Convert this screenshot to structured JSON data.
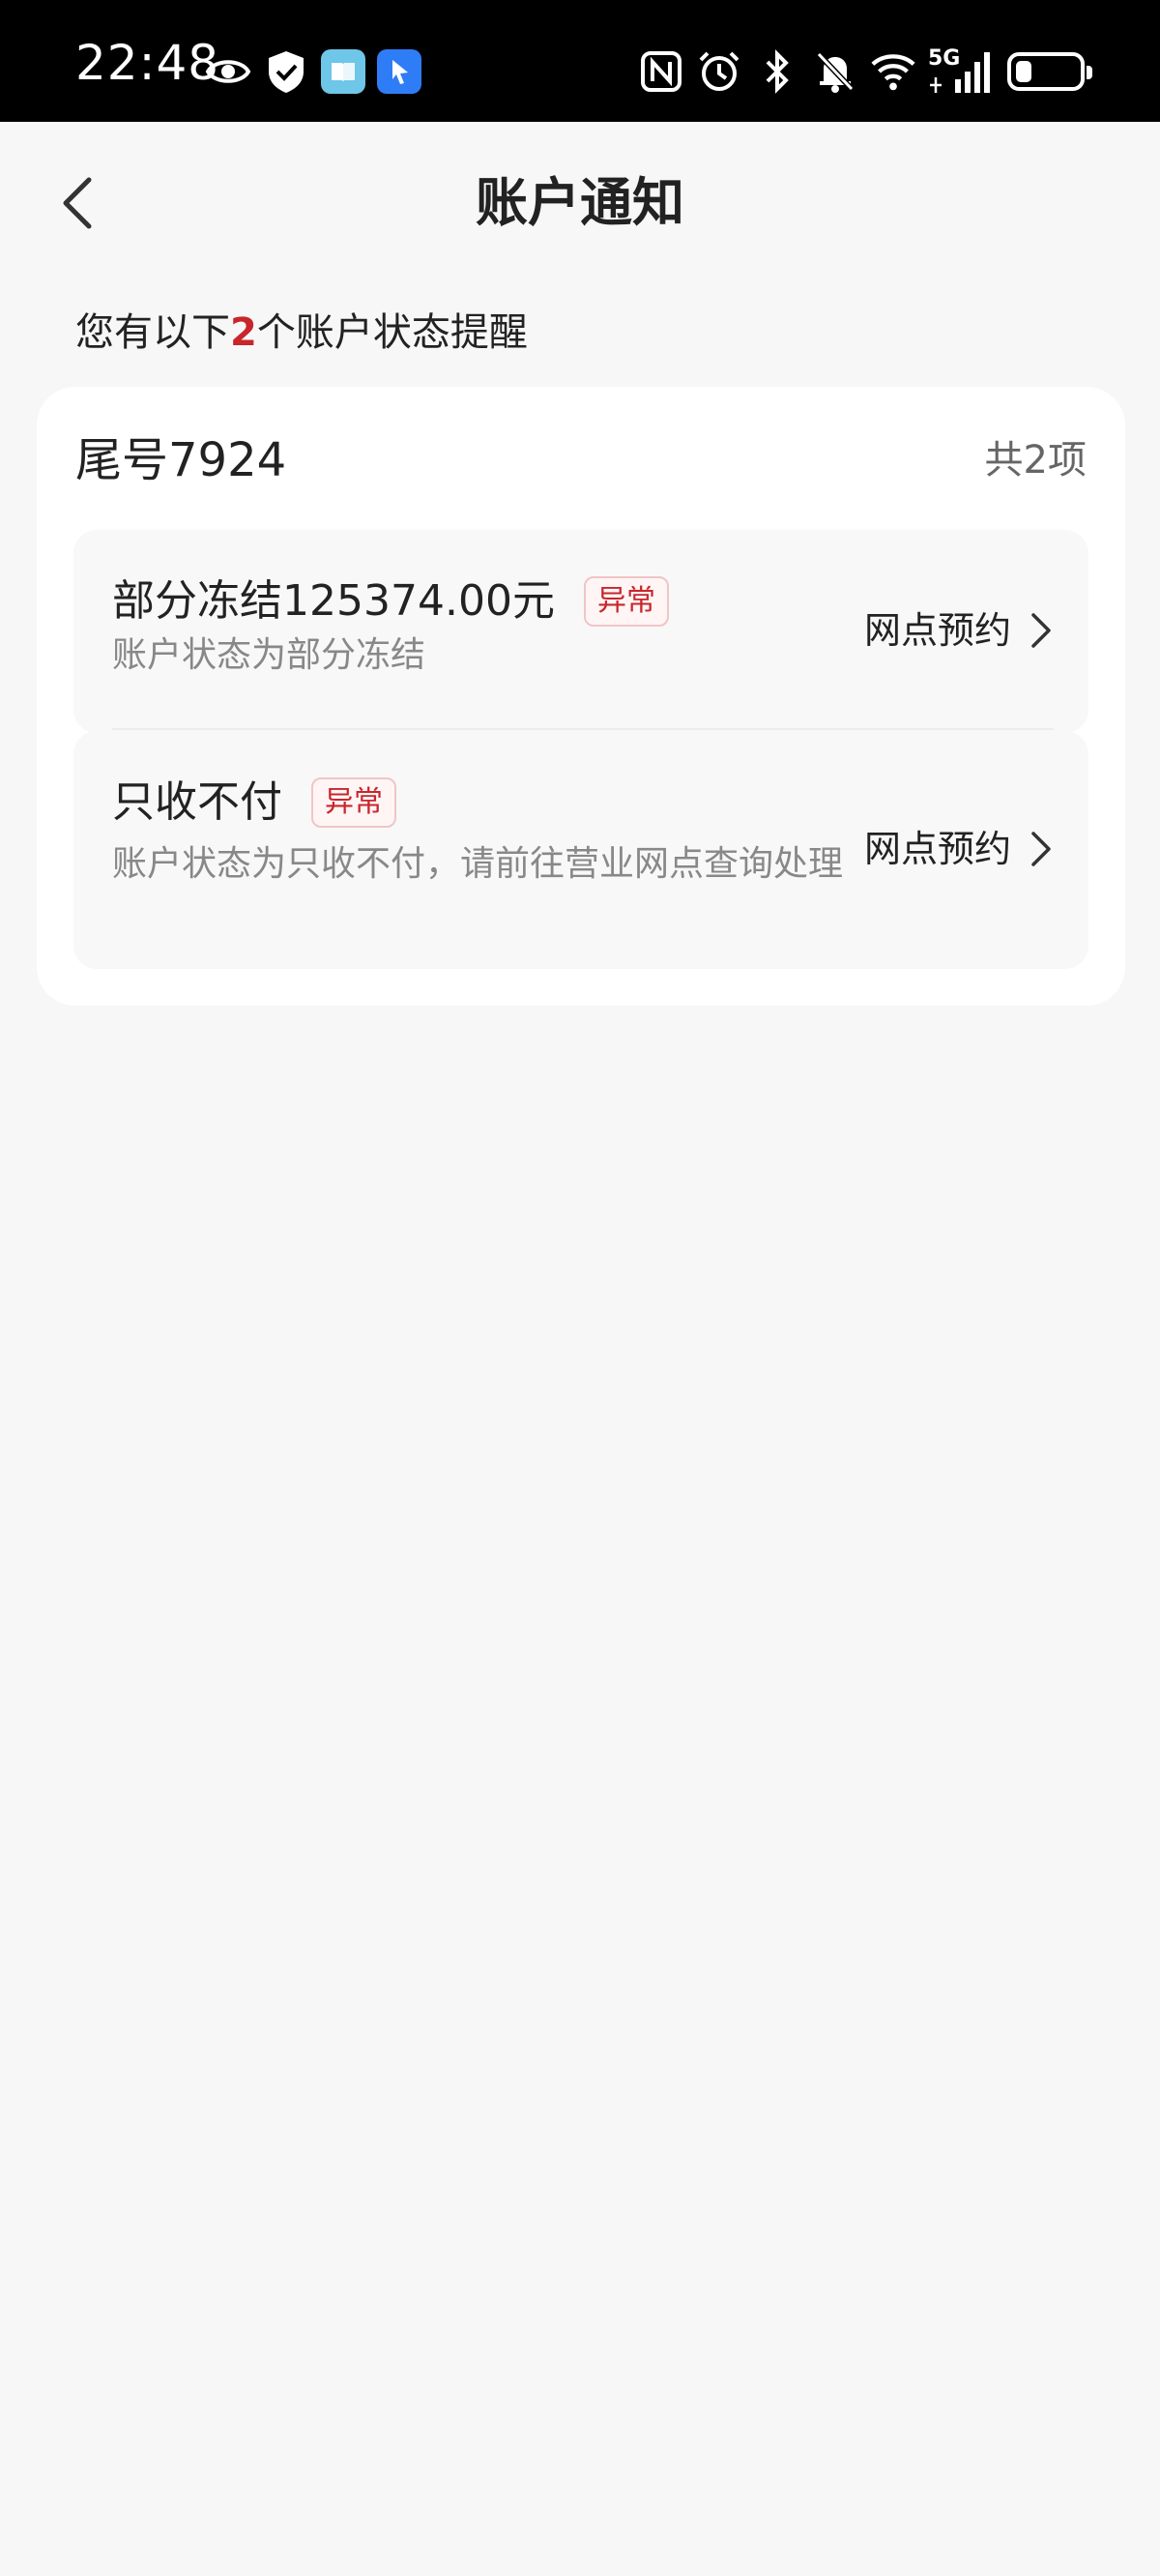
{
  "status_bar": {
    "time": "22:48",
    "left_icons": [
      "eye-icon",
      "shield-check-icon",
      "book-app-icon",
      "navigation-app-icon"
    ],
    "right_icons": [
      "nfc-icon",
      "alarm-icon",
      "bluetooth-icon",
      "bell-off-icon",
      "wifi-icon",
      "cellular-5g-icon",
      "battery-icon"
    ],
    "network_label": "5G",
    "battery_level": 0.25
  },
  "nav": {
    "title": "账户通知",
    "back_icon": "chevron-left-icon"
  },
  "summary": {
    "prefix": "您有以下",
    "count": "2",
    "suffix": "个账户状态提醒"
  },
  "card": {
    "account_label": "尾号7924",
    "total_label": "共2项",
    "items": [
      {
        "title": "部分冻结125374.00元",
        "badge": "异常",
        "description": "账户状态为部分冻结",
        "action": "网点预约"
      },
      {
        "title": "只收不付",
        "badge": "异常",
        "description": "账户状态为只收不付，请前往营业网点查询处理",
        "action": "网点预约"
      }
    ]
  },
  "colors": {
    "accent_red": "#c8262c",
    "page_bg": "#f7f7f7",
    "card_bg": "#ffffff",
    "item_bg": "#f8f8f8"
  }
}
